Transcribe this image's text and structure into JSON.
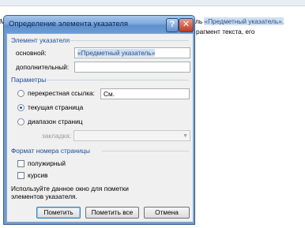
{
  "document": {
    "left_char": "М",
    "line1_prefix": "ль ",
    "line1_highlight": "«Предметный указатель».",
    "line2": "рагмент текста, его"
  },
  "dialog": {
    "title": "Определение элемента указателя",
    "help_glyph": "?",
    "close_glyph": "✕",
    "index_group": {
      "label": "Элемент указателя",
      "main_label": "основной:",
      "main_value": "«Предметный указатель»",
      "sub_label": "дополнительный:",
      "sub_value": ""
    },
    "options_group": {
      "label": "Параметры",
      "cross_ref_label": "перекрестная ссылка:",
      "cross_ref_value": "См.",
      "current_page_label": "текущая страница",
      "page_range_label": "диапазон страниц",
      "bookmark_label": "закладка:",
      "bookmark_value": "",
      "selected": "current_page"
    },
    "format_group": {
      "label": "Формат номера страницы",
      "bold_label": "полужирный",
      "italic_label": "курсив",
      "bold_checked": false,
      "italic_checked": false
    },
    "note": "Используйте данное окно для пометки элементов указателя.",
    "buttons": {
      "mark": "Пометить",
      "mark_all": "Пометить все",
      "cancel": "Отмена"
    }
  },
  "colors": {
    "titlebar": "#6f9cd0",
    "group_label": "#1d4b9a",
    "highlight": "#cfe0f3"
  }
}
